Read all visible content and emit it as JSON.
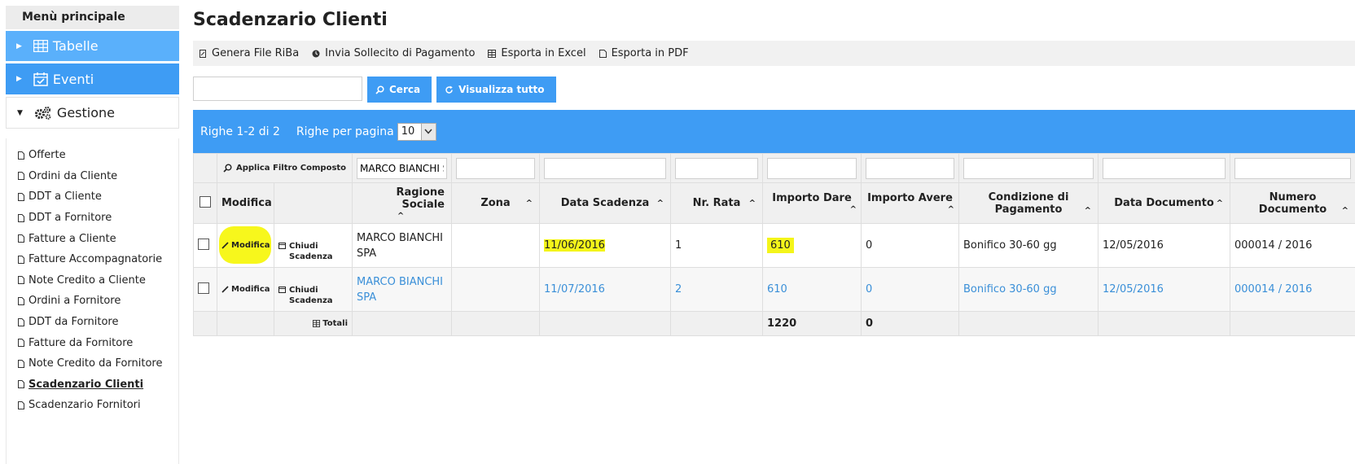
{
  "sidebar": {
    "title": "Menù principale",
    "sections": [
      {
        "label": "Tabelle",
        "icon": "table-icon"
      },
      {
        "label": "Eventi",
        "icon": "calendar-check-icon"
      },
      {
        "label": "Gestione",
        "icon": "gears-icon"
      }
    ],
    "items": [
      "Offerte",
      "Ordini da Cliente",
      "DDT a Cliente",
      "DDT a Fornitore",
      "Fatture a Cliente",
      "Fatture Accompagnatorie",
      "Note Credito a Cliente",
      "Ordini a Fornitore",
      "DDT da Fornitore",
      "Fatture da Fornitore",
      "Note Credito da Fornitore",
      "Scadenzario Clienti",
      "Scadenzario Fornitori"
    ]
  },
  "page": {
    "title": "Scadenzario Clienti"
  },
  "toolbar": {
    "riba": "Genera File RiBa",
    "sollecito": "Invia Sollecito di Pagamento",
    "excel": "Esporta in Excel",
    "pdf": "Esporta in PDF"
  },
  "search": {
    "value": "",
    "cerca": "Cerca",
    "visualizza": "Visualizza tutto"
  },
  "pager": {
    "rows_info": "Righe 1-2 di 2",
    "per_page_label": "Righe per pagina",
    "per_page_value": "10"
  },
  "filter": {
    "applica": "Applica Filtro Composto",
    "ragione_sociale": "MARCO BIANCHI SI"
  },
  "columns": {
    "modifica": "Modifica",
    "ragione_sociale": "Ragione Sociale",
    "zona": "Zona",
    "data_scadenza": "Data Scadenza",
    "nr_rata": "Nr. Rata",
    "importo_dare": "Importo Dare",
    "importo_avere": "Importo Avere",
    "condizione_1": "Condizione di",
    "condizione_2": "Pagamento",
    "data_documento": "Data Documento",
    "numero_1": "Numero",
    "numero_2": "Documento"
  },
  "rows": [
    {
      "modifica": "Modifica",
      "chiudi_1": "Chiudi",
      "chiudi_2": "Scadenza",
      "ragione_1": "MARCO BIANCHI",
      "ragione_2": "SPA",
      "zona": "",
      "data_scadenza": "11/06/2016",
      "nr_rata": "1",
      "importo_dare": "610",
      "importo_avere": "0",
      "condizione": "Bonifico 30-60 gg",
      "data_documento": "12/05/2016",
      "numero_documento": "000014 / 2016"
    },
    {
      "modifica": "Modifica",
      "chiudi_1": "Chiudi",
      "chiudi_2": "Scadenza",
      "ragione_1": "MARCO BIANCHI",
      "ragione_2": "SPA",
      "zona": "",
      "data_scadenza": "11/07/2016",
      "nr_rata": "2",
      "importo_dare": "610",
      "importo_avere": "0",
      "condizione": "Bonifico 30-60 gg",
      "data_documento": "12/05/2016",
      "numero_documento": "000014 / 2016"
    }
  ],
  "totals": {
    "label": "Totali",
    "importo_dare": "1220",
    "importo_avere": "0"
  },
  "colors": {
    "accent": "#3e9cf4",
    "accent_light": "#5ab0fb",
    "link": "#3a8fd8",
    "highlight": "#f4f51a"
  }
}
